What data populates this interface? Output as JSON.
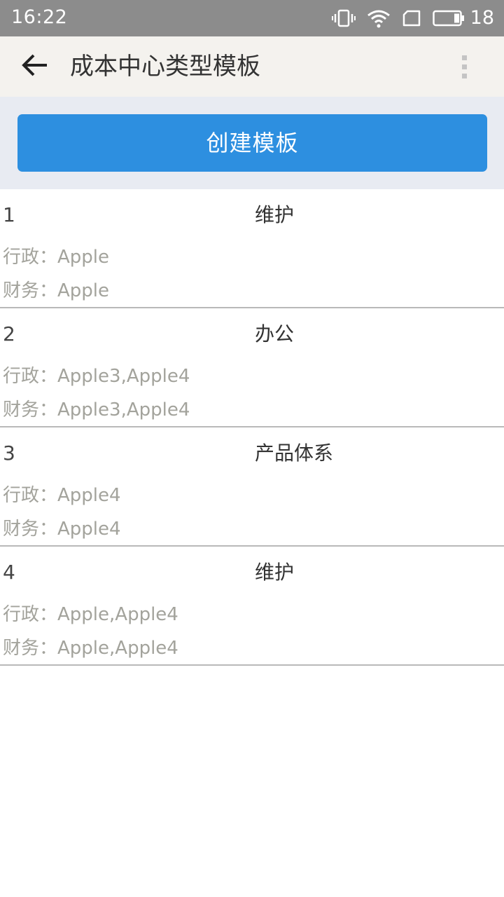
{
  "status_bar": {
    "time": "16:22",
    "battery_level": "18",
    "icons": [
      "vibrate-icon",
      "wifi-icon",
      "sim-icon",
      "battery-icon"
    ]
  },
  "app_bar": {
    "title": "成本中心类型模板",
    "back_icon": "arrow-left-icon",
    "menu_icon": "overflow-menu-icon"
  },
  "actions": {
    "create_label": "创建模板"
  },
  "labels": {
    "admin": "行政：",
    "finance": "财务："
  },
  "templates": [
    {
      "index": "1",
      "type": "维护",
      "admin": "Apple",
      "finance": "Apple"
    },
    {
      "index": "2",
      "type": "办公",
      "admin": "Apple3,Apple4",
      "finance": "Apple3,Apple4"
    },
    {
      "index": "3",
      "type": "产品体系",
      "admin": "Apple4",
      "finance": "Apple4"
    },
    {
      "index": "4",
      "type": "维护",
      "admin": "Apple,Apple4",
      "finance": "Apple,Apple4"
    }
  ],
  "colors": {
    "status_bar": "#8c8c8c",
    "app_bar": "#f4f2ee",
    "action_area": "#e8ebf2",
    "primary_button": "#2d8fe0",
    "secondary_text": "#a3a39c",
    "divider": "#b9b9b9"
  }
}
